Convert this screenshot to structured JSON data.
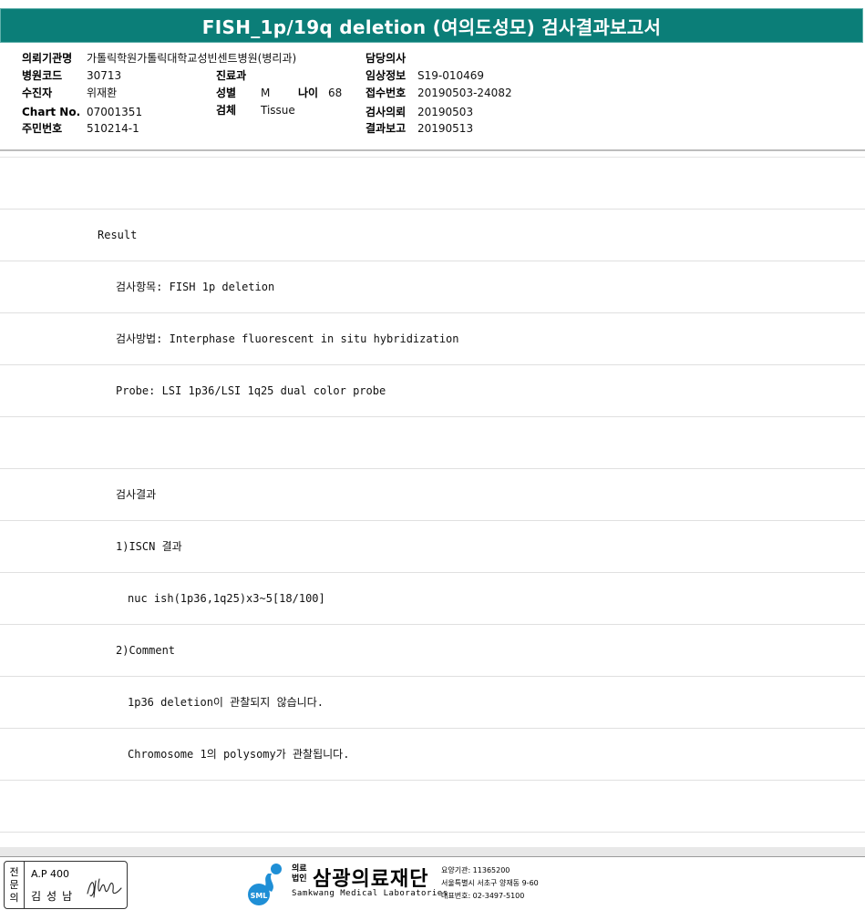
{
  "report": {
    "title": "FISH_1p/19q deletion (여의도성모) 검사결과보고서",
    "teal": "#0b7e78"
  },
  "info": {
    "institution_label": "의뢰기관명",
    "institution_value": "가톨릭학원가톨릭대학교성빈센트병원(병리과)",
    "doctor_label": "담당의사",
    "doctor_value": "",
    "hospital_code_label": "병원코드",
    "hospital_code_value": "30713",
    "department_label": "진료과",
    "department_value": "",
    "clinical_info_label": "임상정보",
    "clinical_info_value": "S19-010469",
    "patient_label": "수진자",
    "patient_value": "위재환",
    "sex_label": "성별",
    "sex_value": "M",
    "age_label": "나이",
    "age_value": "68",
    "receipt_no_label": "접수번호",
    "receipt_no_value": "20190503-24082",
    "chart_no_label": "Chart No.",
    "chart_no_value": "07001351",
    "specimen_label": "검체",
    "specimen_value": "Tissue",
    "request_date_label": "검사의뢰",
    "request_date_value": "20190503",
    "resident_no_label": "주민번호",
    "resident_no_value": "510214-1",
    "report_date_label": "결과보고",
    "report_date_value": "20190513"
  },
  "rows": [
    "",
    "Result",
    "검사항목: FISH 1p deletion",
    "검사방법: Interphase fluorescent in situ hybridization",
    "Probe: LSI 1p36/LSI 1q25 dual color probe",
    "",
    "검사결과",
    "1)ISCN 결과",
    "nuc ish(1p36,1q25)x3~5[18/100]",
    "2)Comment",
    "1p36 deletion이 관찰되지 않습니다.",
    "Chromosome 1의 polysomy가 관찰됩니다.",
    ""
  ],
  "footer": {
    "side_label": [
      "전",
      "문",
      "의"
    ],
    "ap_label": "A.P 400",
    "pathologist_name": "김성남",
    "org_prefix": [
      "의료",
      "법인"
    ],
    "org_name": "삼광의료재단",
    "org_english": "Samkwang Medical Laboratories",
    "logo_text": "SML",
    "contact_code": "요양기관: 11365200",
    "contact_address": "서울특별시 서초구 양재동 9-60",
    "contact_phone": "대표번호: 02-3497-5100",
    "logo_blue": "#1f8fd6"
  }
}
